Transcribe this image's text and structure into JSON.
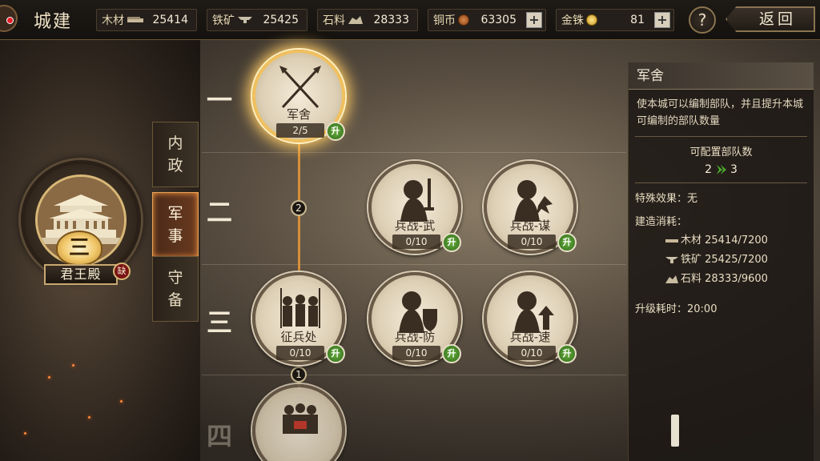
{
  "topbar": {
    "title": "城建",
    "resources": [
      {
        "name": "木材",
        "value": "25414",
        "icon": "wood-icon",
        "plus": false
      },
      {
        "name": "铁矿",
        "value": "25425",
        "icon": "iron-icon",
        "plus": false
      },
      {
        "name": "石料",
        "value": "28333",
        "icon": "stone-icon",
        "plus": false
      },
      {
        "name": "铜币",
        "value": "63305",
        "icon": "copper-coin-icon",
        "plus": true,
        "plus_label": "+"
      },
      {
        "name": "金铢",
        "value": "81",
        "icon": "gold-coin-icon",
        "plus": true,
        "plus_label": "+"
      }
    ],
    "help_label": "?",
    "back_label": "返回"
  },
  "palace": {
    "level": "三",
    "name": "君王殿",
    "warn_label": "缺"
  },
  "categories": [
    {
      "label": "内\n政",
      "active": false
    },
    {
      "label": "军\n事",
      "active": true
    },
    {
      "label": "守\n备",
      "active": false
    }
  ],
  "tiers": [
    "一",
    "二",
    "三",
    "四"
  ],
  "requirements": [
    "2",
    "1"
  ],
  "nodes": [
    {
      "name": "军舍",
      "progress": "2/5",
      "upgrade_label": "升",
      "icon": "crossed-spears-icon",
      "selected": true
    },
    {
      "name": "兵战-武",
      "progress": "0/10",
      "upgrade_label": "升",
      "icon": "warrior-sword-icon",
      "selected": false
    },
    {
      "name": "兵战-谋",
      "progress": "0/10",
      "upgrade_label": "升",
      "icon": "warrior-strategy-icon",
      "selected": false
    },
    {
      "name": "征兵处",
      "progress": "0/10",
      "upgrade_label": "升",
      "icon": "soldiers-icon",
      "selected": false
    },
    {
      "name": "兵战-防",
      "progress": "0/10",
      "upgrade_label": "升",
      "icon": "warrior-shield-icon",
      "selected": false
    },
    {
      "name": "兵战-速",
      "progress": "0/10",
      "upgrade_label": "升",
      "icon": "warrior-speed-icon",
      "selected": false
    },
    {
      "name": "",
      "progress": "",
      "upgrade_label": "",
      "icon": "troops-icon",
      "selected": false
    }
  ],
  "detail": {
    "title": "军舍",
    "description": "使本城可以编制部队，并且提升本城可编制的部队数量",
    "capacity_label": "可配置部队数",
    "capacity_from": "2",
    "capacity_to": "3",
    "special_effect": "特殊效果：无",
    "cost_label": "建造消耗：",
    "costs": [
      {
        "icon": "wood-icon",
        "text": "木材 25414/7200"
      },
      {
        "icon": "iron-icon",
        "text": "铁矿 25425/7200"
      },
      {
        "icon": "stone-icon",
        "text": "石料 28333/9600"
      }
    ],
    "upgrade_time": "升级耗时：20:00"
  },
  "colors": {
    "connector": "#d69038",
    "upgrade_green": "#3e8a22",
    "selected_glow": "#ffcc66"
  }
}
